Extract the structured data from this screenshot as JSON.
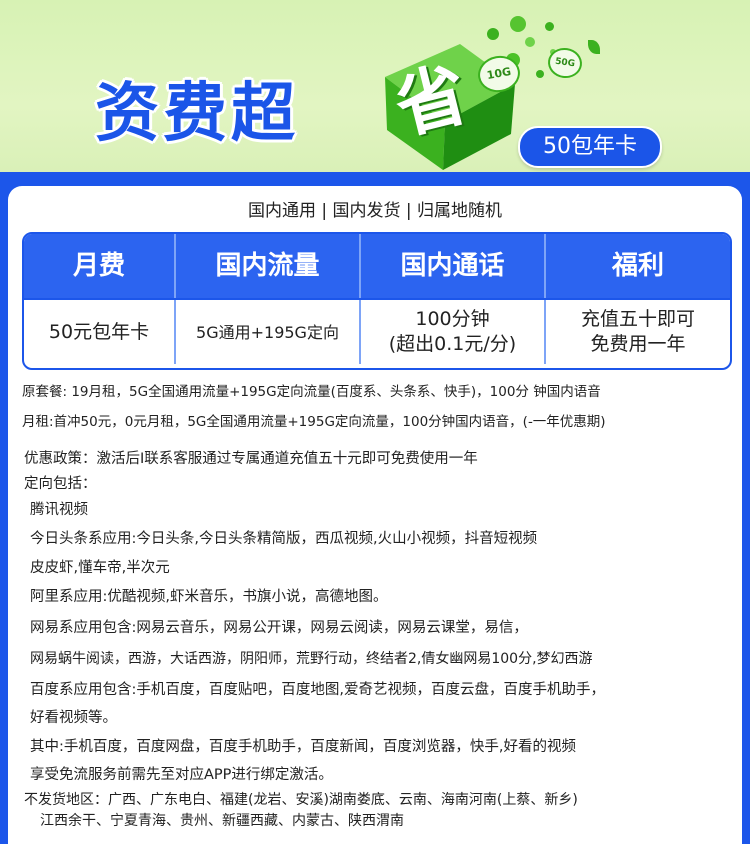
{
  "banner": {
    "title": "资费超",
    "cube_char": "省",
    "badge_label": "50包年卡",
    "tag_10g": "10G",
    "tag_50g": "50G",
    "colors": {
      "brand_blue": "#1c56ea",
      "banner_green": "#d7f2b4",
      "cube_green": "#3bb11f"
    }
  },
  "subtitle": "国内通用 | 国内发货 | 归属地随机",
  "table": {
    "headers": [
      "月费",
      "国内流量",
      "国内通话",
      "福利"
    ],
    "cells": [
      [
        "50元包年卡"
      ],
      [
        "5G通用+195G定向"
      ],
      [
        "100分钟",
        "(超出0.1元/分)"
      ],
      [
        "充值五十即可",
        "免费用一年"
      ]
    ]
  },
  "details": [
    "原套餐: 19月租，5G全国通用流量+195G定向流量(百度系、头条系、快手)，100分 钟国内语音",
    "月租:首冲50元，0元月租，5G全国通用流量+195G定向流量，100分钟国内语音，(-一年优惠期)",
    "优惠政策：激活后I联系客服通过专属通道充值五十元即可免费使用一年",
    "定向包括：",
    "腾讯视频",
    "今日头条系应用:今日头条,今日头条精简版，西瓜视频,火山小视频，抖音短视频",
    "皮皮虾,懂车帝,半次元",
    "阿里系应用:优酷视频,虾米音乐，书旗小说，高德地图。",
    "网易系应用包含:网易云音乐，网易公开课，网易云阅读，网易云课堂，易信，",
    "网易蜗牛阅读，西游，大话西游，阴阳师，荒野行动，终结者2,倩女幽网易100分,梦幻西游",
    "百度系应用包含:手机百度，百度贴吧，百度地图,爱奇艺视频，百度云盘，百度手机助手，",
    "好看视频等。",
    "其中:手机百度，百度网盘，百度手机助手，百度新闻，百度浏览器，快手,好看的视频",
    "享受免流服务前需先至对应APP进行绑定激活。",
    "不发货地区：广西、广东电白、福建(龙岩、安溪)湖南娄底、云南、海南河南(上蔡、新乡)",
    "江西余干、宁夏青海、贵州、新疆西藏、内蒙古、陕西渭南"
  ]
}
